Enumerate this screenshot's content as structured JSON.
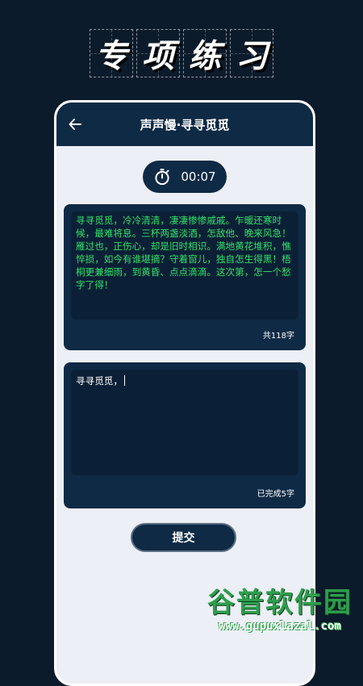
{
  "banner": {
    "chars": [
      "专",
      "项",
      "练",
      "习"
    ]
  },
  "app": {
    "title": "声声慢·寻寻觅觅"
  },
  "timer": {
    "value": "00:07"
  },
  "source_card": {
    "text": "寻寻觅觅，冷冷清清，凄凄惨惨戚戚。乍暖还寒时候，最难将息。三杯两盏淡酒，怎敌他、晚来风急！雁过也，正伤心，却是旧时相识。满地黄花堆积，憔悴损，如今有谁堪摘？守着窗儿，独自怎生得黑！梧桐更兼细雨，到黄昏、点点滴滴。这次第，怎一个愁字了得！",
    "count_label": "共118字"
  },
  "input_card": {
    "value": "寻寻觅觅，",
    "count_label": "已完成5字"
  },
  "submit": {
    "label": "提交"
  },
  "watermark": {
    "logo": "谷普软件园",
    "url": "www.gupuxlazal.com"
  },
  "colors": {
    "background": "#0c1b2b",
    "card": "#0f2a45",
    "source_text": "#35e06a",
    "watermark": "#2f9e4d"
  }
}
